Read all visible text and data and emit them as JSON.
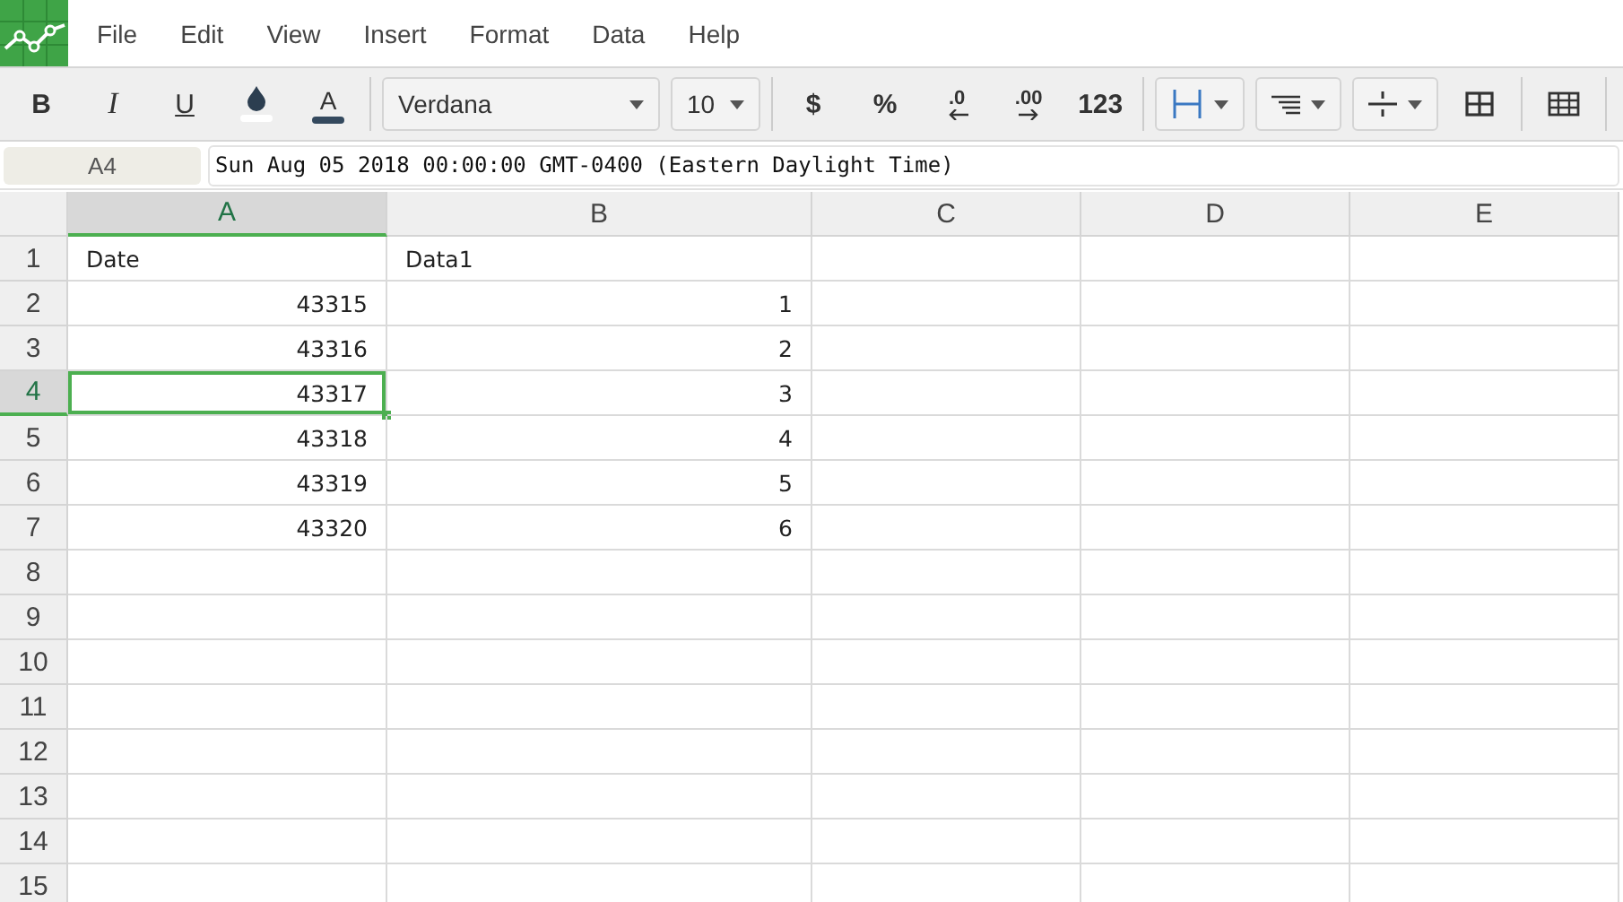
{
  "menu": [
    "File",
    "Edit",
    "View",
    "Insert",
    "Format",
    "Data",
    "Help"
  ],
  "toolbar": {
    "groups": [
      [
        {
          "kind": "bold",
          "label": "B"
        },
        {
          "kind": "italic",
          "label": "I"
        },
        {
          "kind": "underline",
          "label": "U"
        },
        {
          "kind": "fill-color"
        },
        {
          "kind": "font-color",
          "label": "A"
        }
      ],
      [
        {
          "kind": "font-select",
          "value": "Verdana"
        },
        {
          "kind": "size-select",
          "value": "10"
        }
      ],
      [
        {
          "kind": "text",
          "label": "$"
        },
        {
          "kind": "text",
          "label": "%"
        },
        {
          "kind": "decimal-less",
          "label": ".0"
        },
        {
          "kind": "decimal-more",
          "label": ".00"
        },
        {
          "kind": "text",
          "label": "123"
        }
      ],
      [
        {
          "kind": "borders"
        },
        {
          "kind": "align"
        },
        {
          "kind": "valign"
        },
        {
          "kind": "merge"
        }
      ],
      [
        {
          "kind": "table"
        }
      ]
    ]
  },
  "name_box": "A4",
  "formula": "Sun Aug 05 2018 00:00:00 GMT-0400 (Eastern Daylight Time)",
  "columns": [
    {
      "label": "A",
      "selected": true
    },
    {
      "label": "B",
      "selected": false
    },
    {
      "label": "C",
      "selected": false
    },
    {
      "label": "D",
      "selected": false
    },
    {
      "label": "E",
      "selected": false
    }
  ],
  "rows": [
    {
      "label": "1",
      "selected": false,
      "cells": [
        {
          "kind": "text",
          "text": "Date",
          "selected": false
        },
        {
          "kind": "text",
          "text": "Data1",
          "selected": false
        }
      ]
    },
    {
      "label": "2",
      "selected": false,
      "cells": [
        {
          "kind": "number",
          "text": "43315",
          "selected": false
        },
        {
          "kind": "number",
          "text": "1",
          "selected": false
        }
      ]
    },
    {
      "label": "3",
      "selected": false,
      "cells": [
        {
          "kind": "number",
          "text": "43316",
          "selected": false
        },
        {
          "kind": "number",
          "text": "2",
          "selected": false
        }
      ]
    },
    {
      "label": "4",
      "selected": true,
      "cells": [
        {
          "kind": "number",
          "text": "43317",
          "selected": true
        },
        {
          "kind": "number",
          "text": "3",
          "selected": false
        }
      ]
    },
    {
      "label": "5",
      "selected": false,
      "cells": [
        {
          "kind": "number",
          "text": "43318",
          "selected": false
        },
        {
          "kind": "number",
          "text": "4",
          "selected": false
        }
      ]
    },
    {
      "label": "6",
      "selected": false,
      "cells": [
        {
          "kind": "number",
          "text": "43319",
          "selected": false
        },
        {
          "kind": "number",
          "text": "5",
          "selected": false
        }
      ]
    },
    {
      "label": "7",
      "selected": false,
      "cells": [
        {
          "kind": "number",
          "text": "43320",
          "selected": false
        },
        {
          "kind": "number",
          "text": "6",
          "selected": false
        }
      ]
    },
    {
      "label": "8",
      "selected": false
    },
    {
      "label": "9",
      "selected": false
    },
    {
      "label": "10",
      "selected": false
    },
    {
      "label": "11",
      "selected": false
    },
    {
      "label": "12",
      "selected": false
    },
    {
      "label": "13",
      "selected": false
    },
    {
      "label": "14",
      "selected": false
    },
    {
      "label": "15",
      "selected": false
    }
  ]
}
